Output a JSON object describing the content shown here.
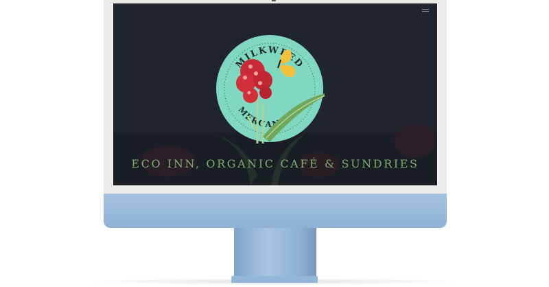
{
  "site": {
    "logo_top_text": "MILKWEED",
    "logo_bottom_text": "MERCANTILE",
    "tagline": "ECO INN, ORGANIC CAFÉ & SUNDRIES"
  },
  "icons": {
    "menu": "hamburger-menu-icon"
  },
  "colors": {
    "screen_background": "#1f242d",
    "logo_circle": "#7fd8bf",
    "flower": "#d1303a",
    "butterfly": "#f4c13b",
    "leaf": "#6fa85a",
    "tagline": "#7fae74",
    "monitor_chin": "#9ebcdc"
  }
}
